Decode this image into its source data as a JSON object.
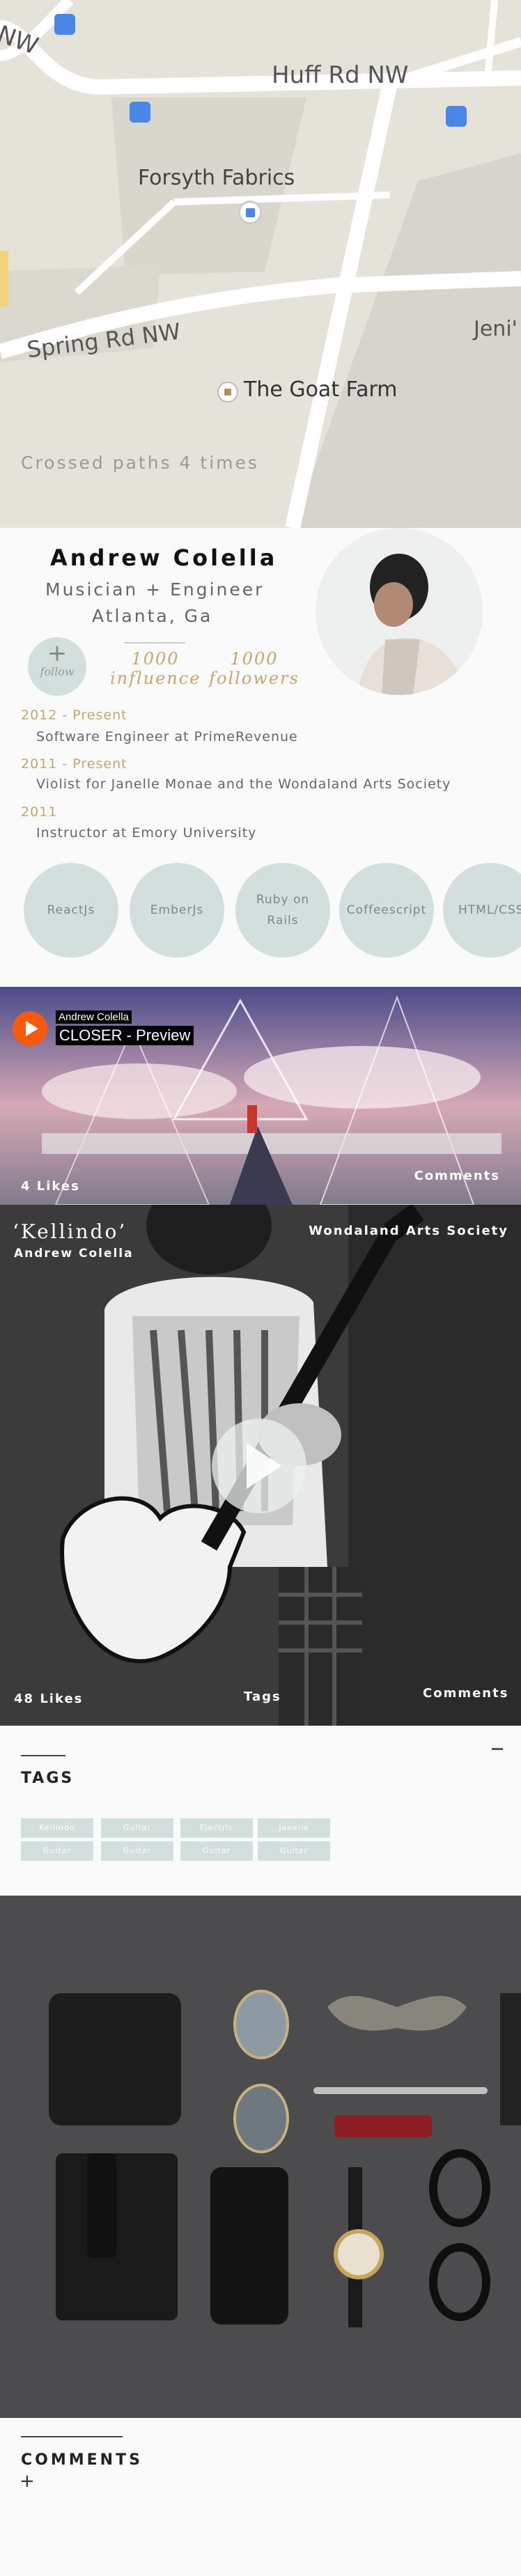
{
  "map": {
    "roads": {
      "huff": "Huff Rd NW",
      "spring": "Spring Rd NW",
      "corner": "NW"
    },
    "places": {
      "forsyth": "Forsyth Fabrics",
      "goat_farm": "The Goat Farm",
      "jeni": "Jeni'"
    },
    "crossed_paths": "Crossed paths 4 times",
    "icons": [
      "bus-stop-icon",
      "shopping-bag-icon",
      "place-marker-icon"
    ]
  },
  "profile": {
    "name": "Andrew Colella",
    "role": "Musician + Engineer",
    "location": "Atlanta, Ga",
    "follow_label": "follow",
    "follow_icon": "+",
    "stats": [
      {
        "value": "1000",
        "label": "influence"
      },
      {
        "value": "1000",
        "label": "followers"
      }
    ],
    "jobs": [
      {
        "years": "2012 - Present",
        "desc": "Software Engineer at PrimeRevenue"
      },
      {
        "years": "2011 - Present",
        "desc": "Violist for Janelle Monae and the Wondaland Arts Society"
      },
      {
        "years": "2011",
        "desc": "Instructor at Emory University"
      }
    ],
    "skills": [
      "ReactJs",
      "EmberJs",
      "Ruby on Rails",
      "Coffeescript",
      "HTML/CSS"
    ]
  },
  "soundcloud": {
    "artist": "Andrew Colella",
    "track": "CLOSER - Preview",
    "likes": "4 Likes",
    "comments": "Comments"
  },
  "video": {
    "title": "‘Kellindo’",
    "artist": "Andrew Colella",
    "society": "Wondaland Arts Society",
    "likes": "48 Likes",
    "tags": "Tags",
    "comments": "Comments"
  },
  "tags": {
    "title": "TAGS",
    "collapse_icon": "minus-icon",
    "items": [
      [
        "Kellindo",
        "Guitar",
        "Electric",
        "Janelle"
      ],
      [
        "Guitar",
        "Guitar",
        "Guitar",
        "Guitar"
      ]
    ]
  },
  "comments": {
    "title": "COMMENTS",
    "add_label": "+"
  },
  "colors": {
    "accent_gold": "#c2a86e",
    "bubble": "#d3dfdd",
    "soundcloud_orange": "#f55a0f"
  }
}
